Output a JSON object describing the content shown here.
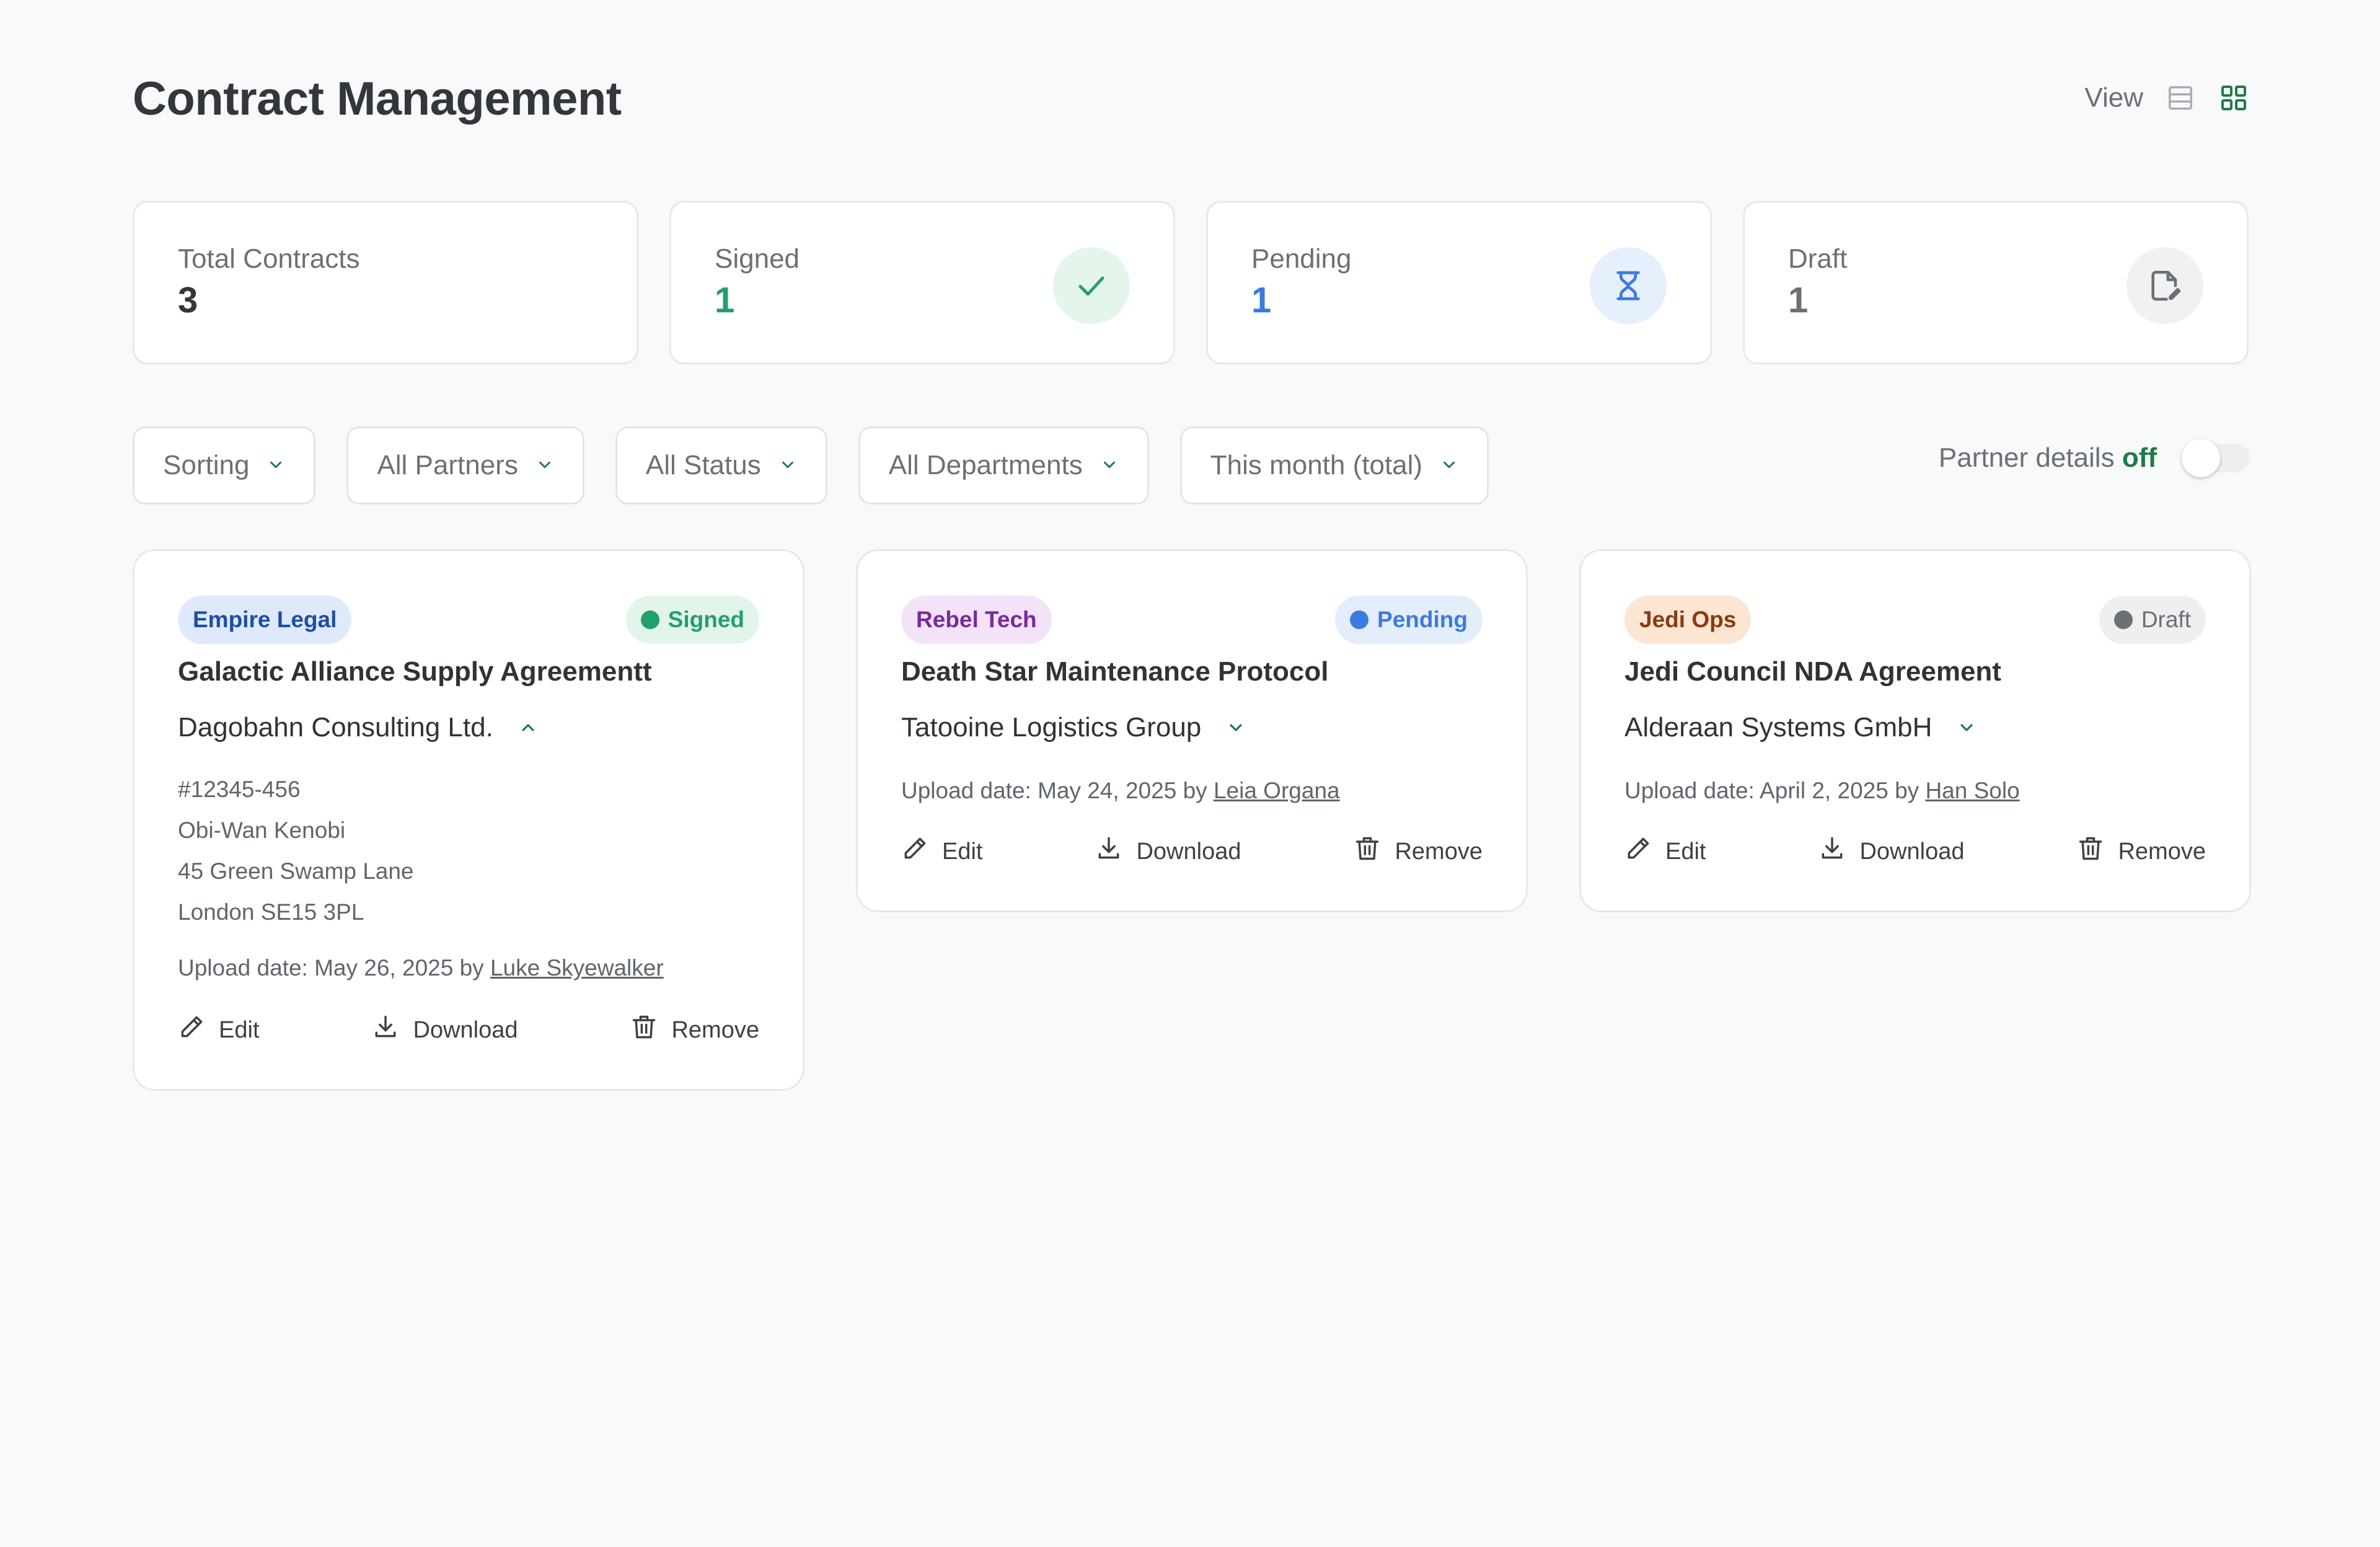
{
  "header": {
    "title": "Contract Management",
    "view_label": "View",
    "view_list_icon": "list-view-icon",
    "view_grid_icon": "grid-view-icon"
  },
  "stats": [
    {
      "label": "Total Contracts",
      "value": "3",
      "color": "#33373c",
      "icon": ""
    },
    {
      "label": "Signed",
      "value": "1",
      "color": "#22a06b",
      "icon": "check-icon",
      "icon_bg": "#e4f5ec"
    },
    {
      "label": "Pending",
      "value": "1",
      "color": "#3b7be0",
      "icon": "hourglass-icon",
      "icon_bg": "#e6effc"
    },
    {
      "label": "Draft",
      "value": "1",
      "color": "#6b7075",
      "icon": "file-edit-icon",
      "icon_bg": "#f0f1f2"
    }
  ],
  "filters": [
    {
      "label": "Sorting"
    },
    {
      "label": "All Partners"
    },
    {
      "label": "All Status"
    },
    {
      "label": "All Departments"
    },
    {
      "label": "This month (total)"
    }
  ],
  "partner_details": {
    "label": "Partner details",
    "state": "off"
  },
  "contracts": [
    {
      "department": "Empire Legal",
      "status": "Signed",
      "title": "Galactic Alliance Supply Agreementt",
      "company": "Dagobahn Consulting Ltd.",
      "expanded": true,
      "details": [
        "#12345-456",
        "Obi-Wan Kenobi",
        "45 Green Swamp Lane",
        "London SE15 3PL"
      ],
      "upload_prefix": "Upload date: May 26, 2025 by",
      "uploader": "Luke Skyewalker"
    },
    {
      "department": "Rebel Tech",
      "status": "Pending",
      "title": "Death Star Maintenance Protocol",
      "company": "Tatooine Logistics Group",
      "expanded": false,
      "upload_prefix": "Upload date: May 24, 2025 by",
      "uploader": "Leia Organa"
    },
    {
      "department": "Jedi Ops",
      "status": "Draft",
      "title": "Jedi Council NDA Agreement",
      "company": "Alderaan Systems GmbH",
      "expanded": false,
      "upload_prefix": "Upload date: April 2, 2025 by",
      "uploader": "Han Solo"
    }
  ],
  "actions": {
    "edit": "Edit",
    "download": "Download",
    "remove": "Remove"
  },
  "colors": {
    "accent": "#1f7a46",
    "signed": "#22a06b",
    "pending": "#3b7be0",
    "draft": "#6b7075"
  }
}
